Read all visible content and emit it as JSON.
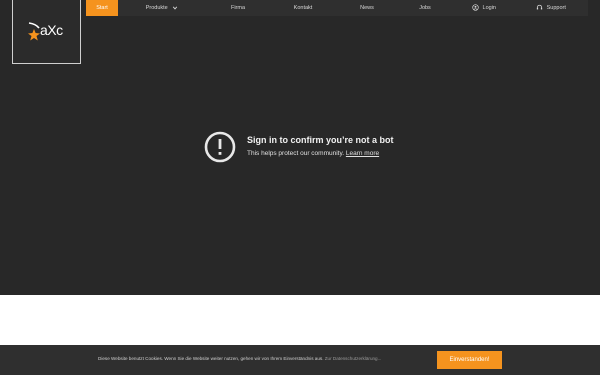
{
  "nav": {
    "items": [
      {
        "label": "Start"
      },
      {
        "label": "Produkte"
      },
      {
        "label": "Firma"
      },
      {
        "label": "Kontakt"
      },
      {
        "label": "News"
      },
      {
        "label": "Jobs"
      },
      {
        "label": "Login"
      },
      {
        "label": "Support"
      }
    ]
  },
  "logo": {
    "text": "aXc"
  },
  "embed": {
    "title": "Sign in to confirm you’re not a bot",
    "subtitle": "This helps protect our community.",
    "learn_more": "Learn more"
  },
  "cookie": {
    "text": "Diese Website benutzt Cookies. Wenn Sie die Website weiter nutzen, gehen wir von Ihrem Einverständnis aus.",
    "link": "Zur Datenschutzerklärung...",
    "button": "Einverstanden!"
  },
  "colors": {
    "accent": "#f5931e",
    "background": "#282828"
  },
  "icons": [
    "chevron-down-icon",
    "user-circle-icon",
    "headset-icon",
    "warning-icon",
    "star-logo-icon"
  ]
}
